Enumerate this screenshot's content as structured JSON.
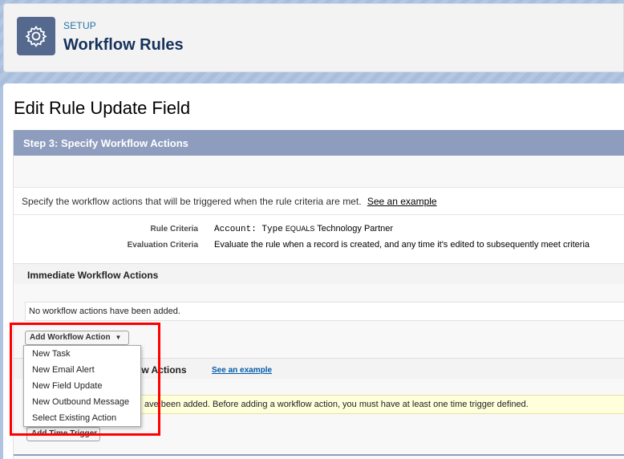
{
  "header": {
    "breadcrumb": "SETUP",
    "title": "Workflow Rules",
    "icon": "gear-icon"
  },
  "page": {
    "title": "Edit Rule Update Field"
  },
  "step": {
    "title": "Step 3: Specify Workflow Actions",
    "description": "Specify the workflow actions that will be triggered when the rule criteria are met.",
    "example_link": "See an example"
  },
  "criteria": {
    "rule_label": "Rule Criteria",
    "rule_field": "Account: Type",
    "rule_operator": "EQUALS",
    "rule_value": "Technology Partner",
    "eval_label": "Evaluation Criteria",
    "eval_value": "Evaluate the rule when a record is created, and any time it's edited to subsequently meet criteria"
  },
  "immediate": {
    "header": "Immediate Workflow Actions",
    "empty_text": "No workflow actions have been added.",
    "add_button": "Add Workflow Action"
  },
  "time_triggered": {
    "header_partial": "ow Actions",
    "example_link": "See an example",
    "warning_partial": "ave been added. Before adding a workflow action, you must have at least one time trigger defined.",
    "add_trigger_button": "Add Time Trigger"
  },
  "dropdown": {
    "items": [
      "New Task",
      "New Email Alert",
      "New Field Update",
      "New Outbound Message",
      "Select Existing Action"
    ]
  },
  "colors": {
    "step_bar": "#8e9dbe",
    "icon_bg": "#54698d",
    "highlight": "#ff0000",
    "warning_bg": "#ffffdc"
  }
}
